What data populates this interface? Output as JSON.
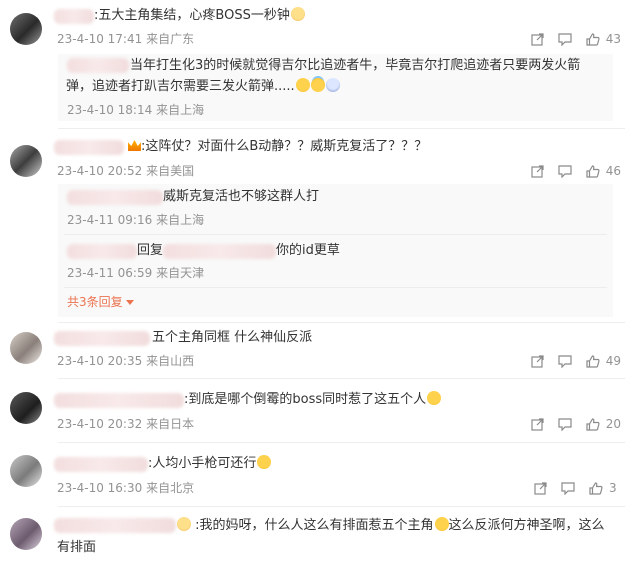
{
  "comments": [
    {
      "sep": ":",
      "text": "五大主角集结，心疼BOSS一秒钟",
      "date": "23-4-10 17:41",
      "location": "来自广东",
      "likes": "43",
      "replies": [
        {
          "line1": "当年打生化3的时候就觉得吉尔比追迹者牛，毕竟吉尔打爬追迹者只要两发火箭",
          "line2": "弹，追迹者打趴吉尔需要三发火箭弹.....",
          "date": "23-4-10 18:14",
          "location": "来自上海"
        }
      ]
    },
    {
      "sep": ":",
      "text": "这阵仗？对面什么B动静？？威斯克复活了？？？",
      "date": "23-4-10 20:52",
      "location": "来自美国",
      "likes": "46",
      "replies": [
        {
          "text": "威斯克复活也不够这群人打",
          "date": "23-4-11 09:16",
          "location": "来自上海"
        },
        {
          "reply_word": "回复",
          "text": "你的id更草",
          "date": "23-4-11 06:59",
          "location": "来自天津"
        }
      ],
      "more_replies": "共3条回复"
    },
    {
      "text": "五个主角同框 什么神仙反派",
      "date": "23-4-10 20:35",
      "location": "来自山西",
      "likes": "49"
    },
    {
      "sep": ":",
      "text": "到底是哪个倒霉的boss同时惹了这五个人",
      "date": "23-4-10 20:32",
      "location": "来自日本",
      "likes": "20"
    },
    {
      "sep": ":",
      "text": "人均小手枪可还行",
      "date": "23-4-10 16:30",
      "location": "来自北京",
      "likes": "3"
    },
    {
      "sep": ":",
      "text_a": "我的妈呀，什么人这么有排面惹五个主角",
      "text_b": "这么反派何方神圣啊，这么",
      "text_c": "有排面"
    }
  ],
  "icons": {
    "share": "share-icon",
    "comment": "comment-icon",
    "like": "like-icon",
    "expand": "caret-down-icon"
  },
  "colors": {
    "meta": "#939393",
    "text": "#333333",
    "more_link": "#eb7350",
    "reply_bg": "#f9f9f9"
  }
}
